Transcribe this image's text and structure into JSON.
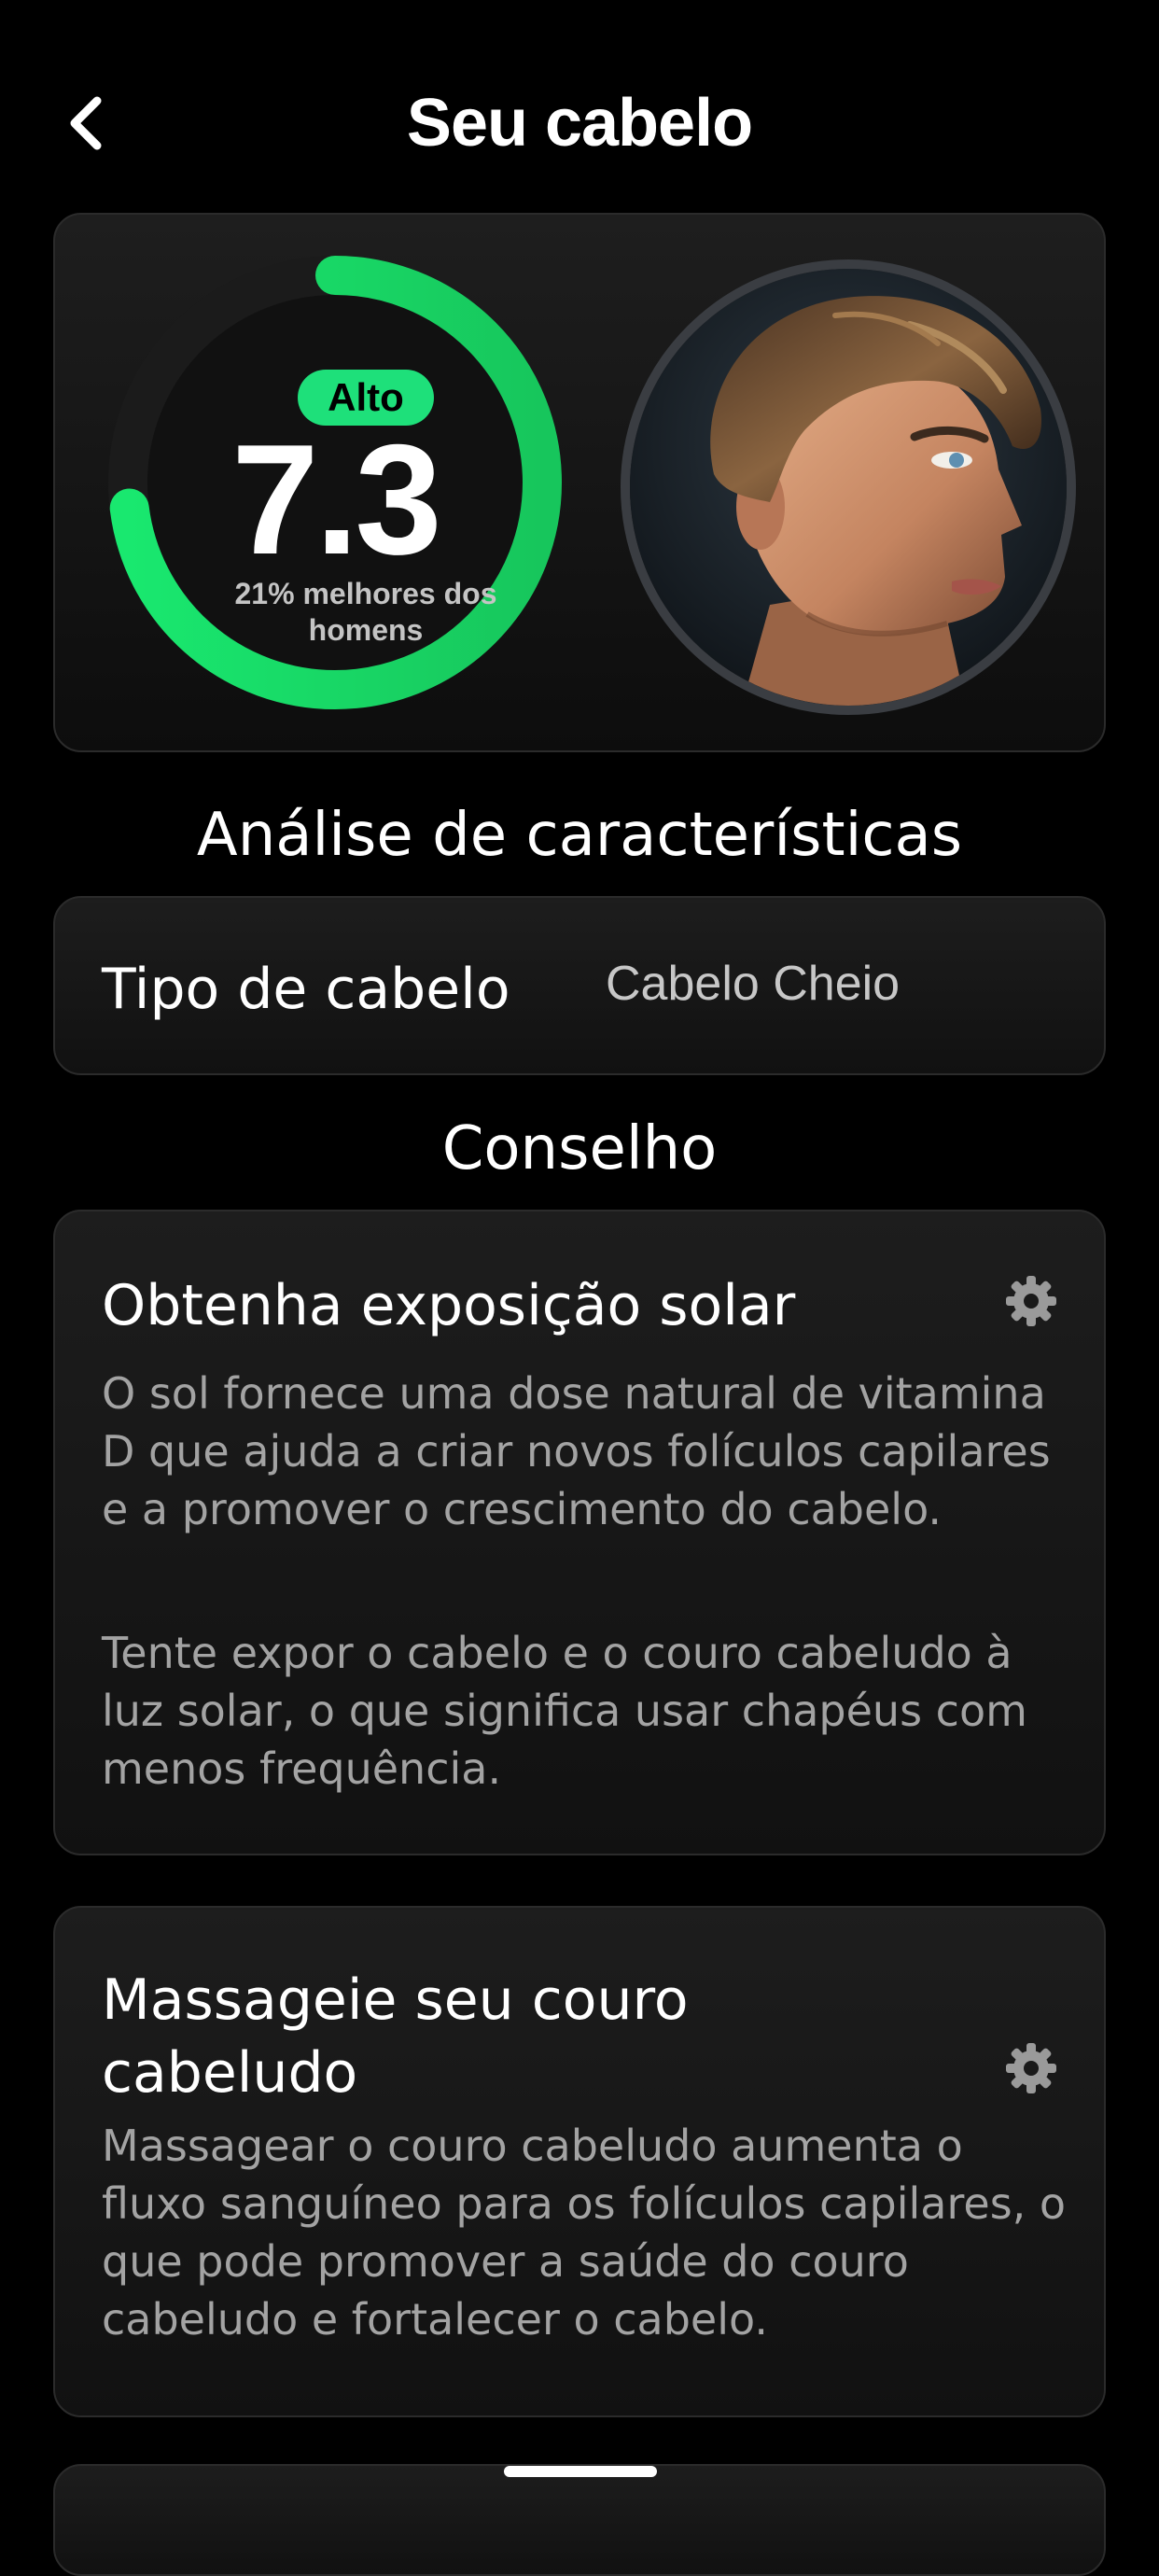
{
  "header": {
    "title": "Seu cabelo",
    "back_icon": "chevron-left-icon"
  },
  "score": {
    "level": "Alto",
    "value": "7.3",
    "subtitle": "21% melhores dos homens",
    "progress_fraction": 0.73,
    "accent_color": "#1ee07a"
  },
  "traits": {
    "title": "Análise de características",
    "items": [
      {
        "label": "Tipo de cabelo",
        "value": "Cabelo Cheio"
      }
    ]
  },
  "advice": {
    "title": "Conselho",
    "items": [
      {
        "title": "Obtenha exposição solar",
        "icon": "gear-icon",
        "paragraphs": [
          "O sol fornece uma dose natural de vitamina D que ajuda a criar novos folículos capilares e a promover o crescimento do cabelo.",
          "Tente expor o cabelo e o couro cabeludo à luz solar, o que significa usar chapéus com menos frequência."
        ]
      },
      {
        "title": "Massageie seu couro cabeludo",
        "icon": "gear-icon",
        "paragraphs": [
          "Massagear o couro cabeludo aumenta o fluxo sanguíneo para os folículos capilares, o que pode promover a saúde do couro cabeludo e fortalecer o cabelo."
        ]
      }
    ]
  }
}
